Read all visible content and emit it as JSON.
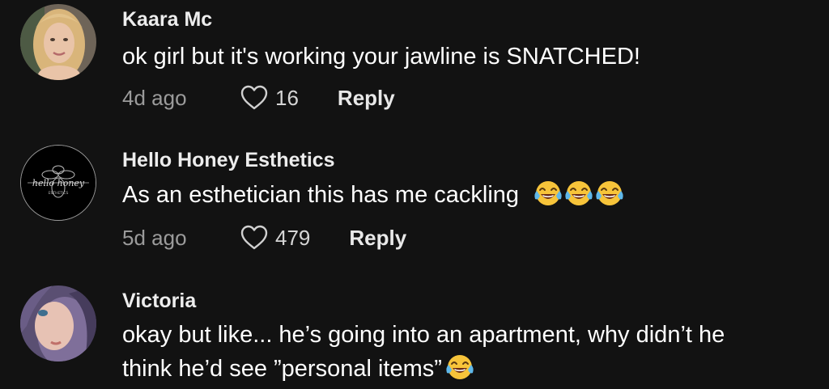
{
  "comments": [
    {
      "username": "Kaara Mc",
      "text": "ok girl but it's working your jawline is SNATCHED!",
      "time": "4d ago",
      "likes": "16",
      "reply_label": "Reply",
      "emoji_count": 0
    },
    {
      "username": "Hello Honey Esthetics",
      "text": "As an esthetician this has me cackling",
      "time": "5d ago",
      "likes": "479",
      "reply_label": "Reply",
      "emoji": "face-with-tears-of-joy",
      "emoji_count": 3
    },
    {
      "username": "Victoria",
      "text_line1": "okay but like... he’s going into an apartment, why didn’t he",
      "text_line2": "think he’d see ”personal items”",
      "emoji": "face-with-tears-of-joy",
      "emoji_count": 1
    }
  ],
  "avatar_logo_text": "hello honey",
  "avatar_logo_subtext": "ESTHETICS",
  "colors": {
    "background": "#121212",
    "username": "#ededed",
    "text": "#ffffff",
    "meta": "#9b9b9b"
  }
}
